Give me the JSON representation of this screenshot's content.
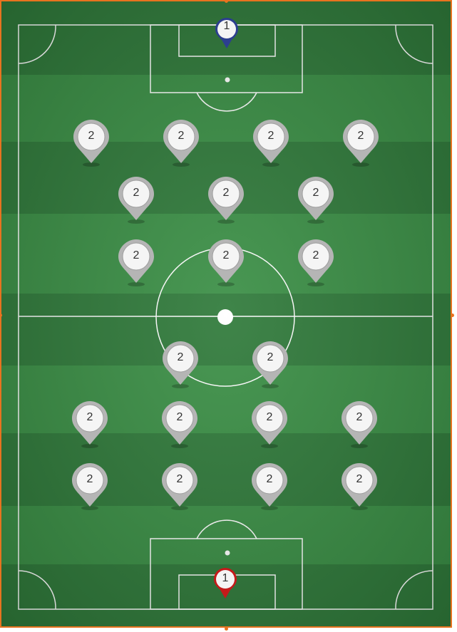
{
  "colors": {
    "stripe_dark": "#2f7a3a",
    "stripe_light": "#3a8f45",
    "lines": "#ffffff",
    "border": "#e8731f",
    "marker_gray": "#b5b5b5",
    "gk_top": "#2c3e8f",
    "gk_bottom": "#c41a1a"
  },
  "goalkeepers": [
    {
      "label": "1",
      "team": "top",
      "icon": "map-pin-icon"
    },
    {
      "label": "1",
      "team": "bottom",
      "icon": "map-pin-icon"
    }
  ],
  "players": [
    {
      "label": "2"
    },
    {
      "label": "2"
    },
    {
      "label": "2"
    },
    {
      "label": "2"
    },
    {
      "label": "2"
    },
    {
      "label": "2"
    },
    {
      "label": "2"
    },
    {
      "label": "2"
    },
    {
      "label": "2"
    },
    {
      "label": "2"
    },
    {
      "label": "2"
    },
    {
      "label": "2"
    },
    {
      "label": "2"
    },
    {
      "label": "2"
    },
    {
      "label": "2"
    },
    {
      "label": "2"
    },
    {
      "label": "2"
    },
    {
      "label": "2"
    },
    {
      "label": "2"
    },
    {
      "label": "2"
    }
  ]
}
